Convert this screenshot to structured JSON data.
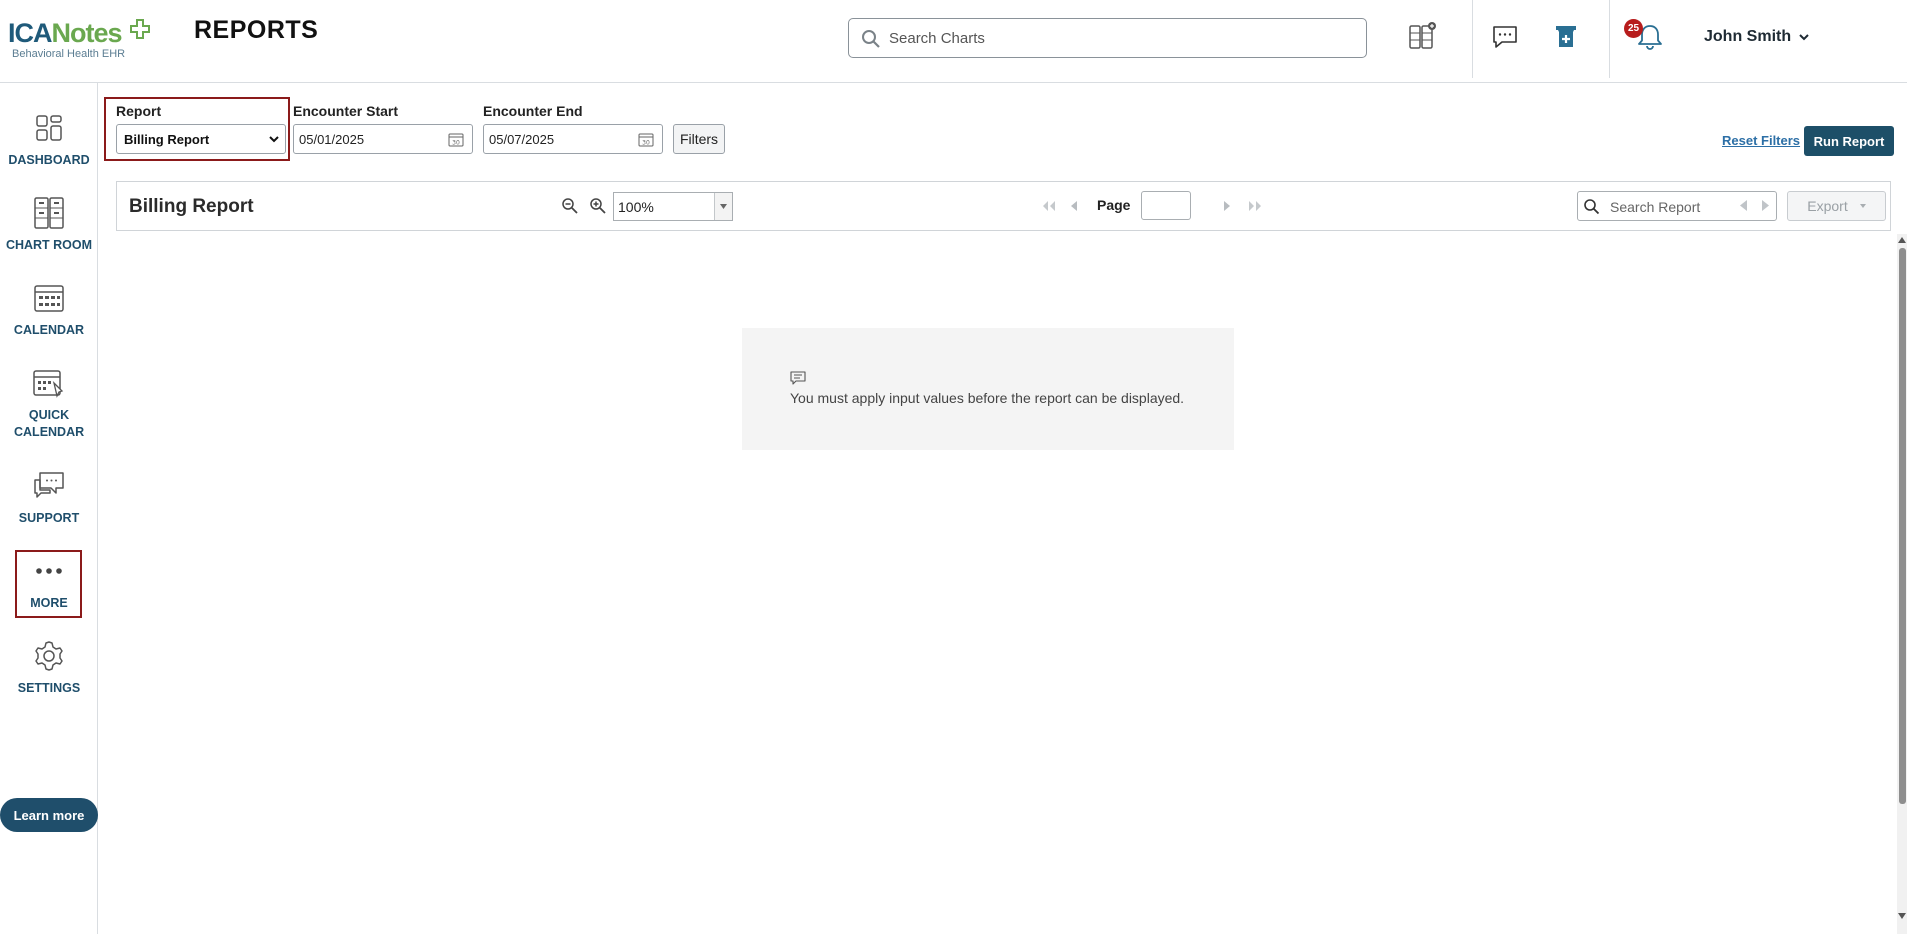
{
  "header": {
    "logo_brand_1": "ICA",
    "logo_brand_2": "Notes",
    "logo_tagline": "Behavioral Health EHR",
    "page_title": "REPORTS",
    "search_placeholder": "Search Charts",
    "notification_count": "25",
    "user_name": "John Smith"
  },
  "sidebar": {
    "items": [
      {
        "label": "DASHBOARD",
        "icon": "dashboard-icon"
      },
      {
        "label": "CHART ROOM",
        "icon": "file-cabinet-icon"
      },
      {
        "label": "CALENDAR",
        "icon": "calendar-icon"
      },
      {
        "label": "QUICK CALENDAR",
        "icon": "quick-calendar-icon"
      },
      {
        "label": "SUPPORT",
        "icon": "support-chat-icon"
      },
      {
        "label": "MORE",
        "icon": "more-dots-icon"
      },
      {
        "label": "SETTINGS",
        "icon": "gear-icon"
      }
    ],
    "learn_more": "Learn more"
  },
  "filters": {
    "report_label": "Report",
    "report_value": "Billing Report",
    "encounter_start_label": "Encounter Start",
    "encounter_start_value": "05/01/2025",
    "encounter_end_label": "Encounter End",
    "encounter_end_value": "05/07/2025",
    "filters_button": "Filters",
    "reset_filters": "Reset Filters",
    "run_report": "Run Report"
  },
  "viewer": {
    "title": "Billing Report",
    "zoom_value": "100%",
    "page_label": "Page",
    "page_value": "",
    "search_placeholder": "Search Report",
    "export_label": "Export"
  },
  "message": {
    "text": "You must apply input values before the report can be displayed."
  },
  "colors": {
    "brand_dark": "#1f4e6b",
    "brand_green": "#6aa84f",
    "highlight_border": "#8b1a1a",
    "badge_red": "#b71c1c"
  }
}
